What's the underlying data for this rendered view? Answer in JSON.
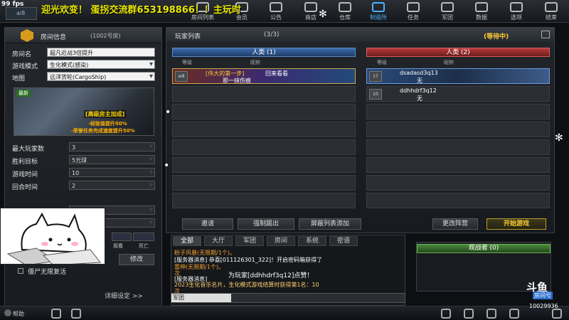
{
  "overlay": {
    "fps": "99 fps",
    "marquee": "迎光欢变！ 蛋拐交流群653198866！！主玩时",
    "webcam_caption": ""
  },
  "topbar": {
    "player_chip": "ai8",
    "items": [
      {
        "label": "房间列表"
      },
      {
        "label": "会员"
      },
      {
        "label": "公告"
      },
      {
        "label": "商店"
      },
      {
        "label": "仓库"
      },
      {
        "label": "制造所"
      },
      {
        "label": "任务"
      },
      {
        "label": "军团"
      },
      {
        "label": "数据"
      },
      {
        "label": "选项"
      },
      {
        "label": "结束"
      }
    ]
  },
  "room": {
    "title": "房间信息",
    "number": "(1002号房)",
    "fields": [
      {
        "label": "房间名",
        "value": "超凡近战3倍提升"
      },
      {
        "label": "游戏模式",
        "value": "生化模式(感染)"
      },
      {
        "label": "地图",
        "value": "远洋货轮(CargoShip)"
      }
    ],
    "map_badge": "最新",
    "bonus_title": "[高级房主加成]",
    "bonus_1": "-经验值提升50%",
    "bonus_2": "-荣誉任务完成速度提升50%",
    "settings": [
      {
        "label": "最大玩家数",
        "value": "3"
      },
      {
        "label": "胜利目标",
        "value": "5光球"
      },
      {
        "label": "游戏时间",
        "value": "10"
      },
      {
        "label": "回合时间",
        "value": "2"
      }
    ],
    "ctrl_a_label": "观看",
    "ctrl_b_label": "死亡",
    "modify_button": "修改",
    "zombie_label": "僵尸无限复活",
    "detail_settings": "详细设定 >>"
  },
  "players": {
    "title": "玩家列表",
    "count": "(3/3)",
    "status": "(等待中)",
    "team_left": "人类 (1)",
    "team_right": "人类 (2)",
    "col_level": "等级",
    "col_name": "昵称",
    "left_slots": [
      {
        "level": "ai8",
        "name": "[伟大的第一步]",
        "sub": "那一抹伤痕",
        "extra": "回来看看"
      }
    ],
    "right_slots": [
      {
        "level": "17",
        "name": "dsadasd3q13",
        "sub": "无"
      },
      {
        "level": "10",
        "name": "ddhhdrf3q12",
        "sub": "无"
      }
    ],
    "buttons": {
      "invite": "邀请",
      "kick": "强制踢出",
      "block": "屏蔽列表添加",
      "change_team": "更改阵营",
      "start": "开始游戏"
    }
  },
  "chat": {
    "tabs": [
      "全部",
      "大厅",
      "军团",
      "房间",
      "系统",
      "密语"
    ],
    "lines": [
      {
        "text": "粉子风暴(无限期/1个)。",
        "color": "#f0a030"
      },
      {
        "text": "[服务器消息] 恭喜[011126301_322]！开启密码箱获得了",
        "color": "#ffffff"
      },
      {
        "text": "雷神(无限期/1个)。",
        "color": "#f0a030"
      },
      {
        "text": "次",
        "color": "#f0a030"
      },
      {
        "text": "[服务器消息]",
        "color": "#ffffff"
      },
      {
        "text": "2023生化音乐名片，生化模式游戏结算时获得第1名：10",
        "color": "#ffd070"
      },
      {
        "text": "次",
        "color": "#f0a030"
      }
    ],
    "toast": "为玩家[ddhhdrf3q12]点赞！",
    "channel": "军团"
  },
  "spectator": {
    "title": "观战者 (0)"
  },
  "bottom": {
    "help": "帮助"
  },
  "stream": {
    "logo": "斗鱼",
    "room_label": "房间号",
    "room_number": "10029936"
  }
}
